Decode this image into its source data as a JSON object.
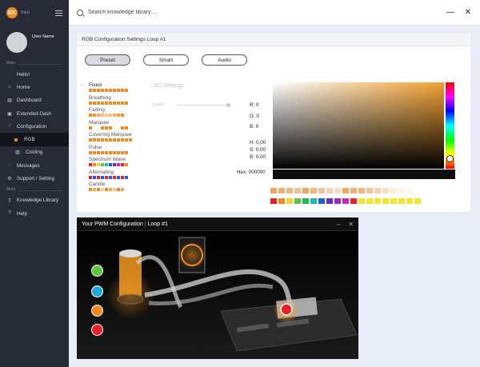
{
  "app": {
    "logo_text": "EK",
    "brand_text": "Hard"
  },
  "sidebar": {
    "user_name": "User Name",
    "section_main": "Main",
    "section_more": "More",
    "items": [
      {
        "label": "Hello!",
        "icon": "none"
      },
      {
        "label": "Home",
        "icon": "home-icon"
      },
      {
        "label": "Dashboard",
        "icon": "dashboard-icon"
      },
      {
        "label": "Extended Dash",
        "icon": "extended-dash-icon"
      },
      {
        "label": "Configuration",
        "icon": "configuration-icon"
      },
      {
        "label": "RGB",
        "icon": "dot-icon",
        "active": true
      },
      {
        "label": "Cooling",
        "icon": "cooling-icon"
      },
      {
        "label": "Messages",
        "icon": "messages-icon"
      },
      {
        "label": "Support / Setting",
        "icon": "gear-icon"
      }
    ],
    "more_items": [
      {
        "label": "Knowledge Library",
        "icon": "book-icon"
      },
      {
        "label": "Help",
        "icon": "help-icon"
      }
    ]
  },
  "search": {
    "placeholder": "Search knowledge library ..."
  },
  "rgb": {
    "title": "RGB Configuration Settings Loop #1",
    "tabs": [
      "Preset",
      "Smart",
      "Audio"
    ],
    "selected_tab": "Preset",
    "led_settings_label": "LED Settings",
    "speed_label": "Speed",
    "effects": [
      "Fixed",
      "Breathing",
      "Fading",
      "Marquee",
      "Covering Marquee",
      "Pulse",
      "Spectrum Wave",
      "Alternating",
      "Candle"
    ],
    "selected_effect": "Fixed",
    "values": {
      "r": "R: 0",
      "g": "G: 0",
      "b": "B: 0",
      "h": "H: 0,00",
      "s": "S: 0,00",
      "v": "B: 0,00"
    },
    "hex": "Hex: 000000",
    "accent_color": "#f08a1c",
    "picker_hue_color": "#f2a030"
  },
  "pwm": {
    "title": "Your PWM Configuration",
    "loop": "Loop #1"
  }
}
